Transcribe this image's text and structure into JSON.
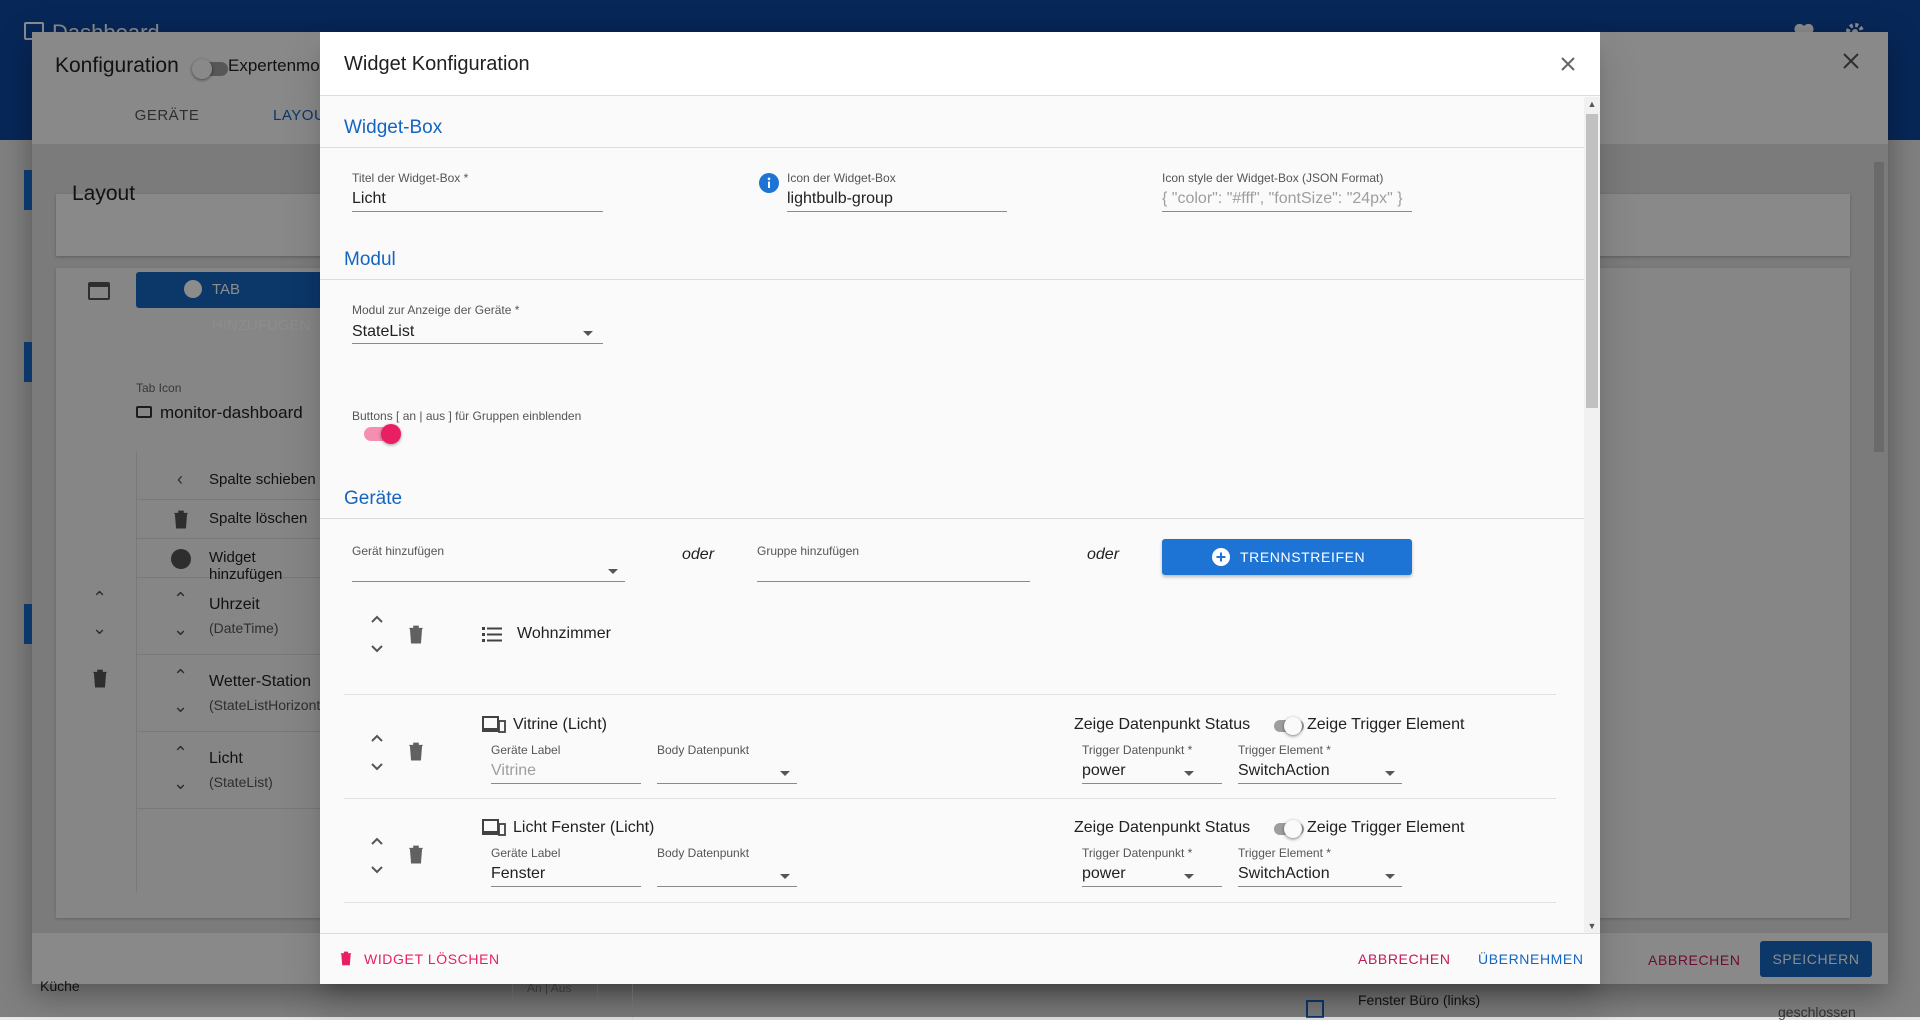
{
  "background": {
    "app_title": "Dashboard",
    "konfig_title": "Konfiguration",
    "expert_mode_label": "Expertenmodus",
    "tabs": [
      "GERÄTE",
      "LAYOUT"
    ],
    "layout_title": "Layout",
    "tab_add_label": "TAB HINZUFÜGEN",
    "tab_icon_label": "Tab Icon",
    "tab_icon_value": "monitor-dashboard",
    "column_actions": [
      "Spalte schieben",
      "Spalte löschen",
      "Widget hinzufügen"
    ],
    "widgets": [
      {
        "title": "Uhrzeit",
        "module": "(DateTime)"
      },
      {
        "title": "Wetter-Station",
        "module": "(StateListHorizontal)"
      },
      {
        "title": "Licht",
        "module": "(StateList)"
      }
    ],
    "footer_cancel": "ABBRECHEN",
    "footer_save": "SPEICHERN",
    "bottom_left_text": "Küche",
    "bottom_right_text": "Fenster Büro (links)",
    "bottom_right_status": "geschlossen",
    "an_aus": "An | Aus"
  },
  "dialog": {
    "title": "Widget Konfiguration",
    "widget_box": {
      "section_title": "Widget-Box",
      "title_label": "Titel der Widget-Box *",
      "title_value": "Licht",
      "icon_label": "Icon der Widget-Box",
      "icon_value": "lightbulb-group",
      "icon_style_label": "Icon style der Widget-Box (JSON Format)",
      "icon_style_placeholder": "{ \"color\": \"#fff\", \"fontSize\": \"24px\" }"
    },
    "modul": {
      "section_title": "Modul",
      "module_label": "Modul zur Anzeige der Geräte *",
      "module_value": "StateList",
      "buttons_label": "Buttons [ an | aus ] für Gruppen einblenden",
      "buttons_enabled": true
    },
    "geraete": {
      "section_title": "Geräte",
      "add_device_label": "Gerät hinzufügen",
      "or_1": "oder",
      "add_group_label": "Gruppe hinzufügen",
      "or_2": "oder",
      "separator_button": "TRENNSTREIFEN",
      "group_row": {
        "name": "Wohnzimmer"
      },
      "devices": [
        {
          "name": "Vitrine (Licht)",
          "label_caption": "Geräte Label",
          "label_value": "",
          "label_placeholder": "Vitrine",
          "body_caption": "Body Datenpunkt",
          "body_value": "",
          "show_status_label": "Zeige Datenpunkt Status",
          "show_trigger_label": "Zeige Trigger Element",
          "trigger_dp_caption": "Trigger Datenpunkt *",
          "trigger_dp_value": "power",
          "trigger_el_caption": "Trigger Element *",
          "trigger_el_value": "SwitchAction"
        },
        {
          "name": "Licht Fenster (Licht)",
          "label_caption": "Geräte Label",
          "label_value": "Fenster",
          "label_placeholder": "",
          "body_caption": "Body Datenpunkt",
          "body_value": "",
          "show_status_label": "Zeige Datenpunkt Status",
          "show_trigger_label": "Zeige Trigger Element",
          "trigger_dp_caption": "Trigger Datenpunkt *",
          "trigger_dp_value": "power",
          "trigger_el_caption": "Trigger Element *",
          "trigger_el_value": "SwitchAction"
        }
      ]
    },
    "footer": {
      "delete_label": "WIDGET LÖSCHEN",
      "cancel_label": "ABBRECHEN",
      "apply_label": "ÜBERNEHMEN"
    }
  },
  "colors": {
    "primary": "#1565c0",
    "accent": "#e91e63",
    "danger": "#e91e63",
    "appbar": "#0d47a1"
  },
  "icons": [
    "info-icon",
    "trash-icon",
    "chevron-up-icon",
    "chevron-down-icon",
    "list-icon",
    "devices-icon",
    "plus-circle-icon",
    "close-icon",
    "heart-icon",
    "gear-icon",
    "monitor-dashboard-icon"
  ]
}
